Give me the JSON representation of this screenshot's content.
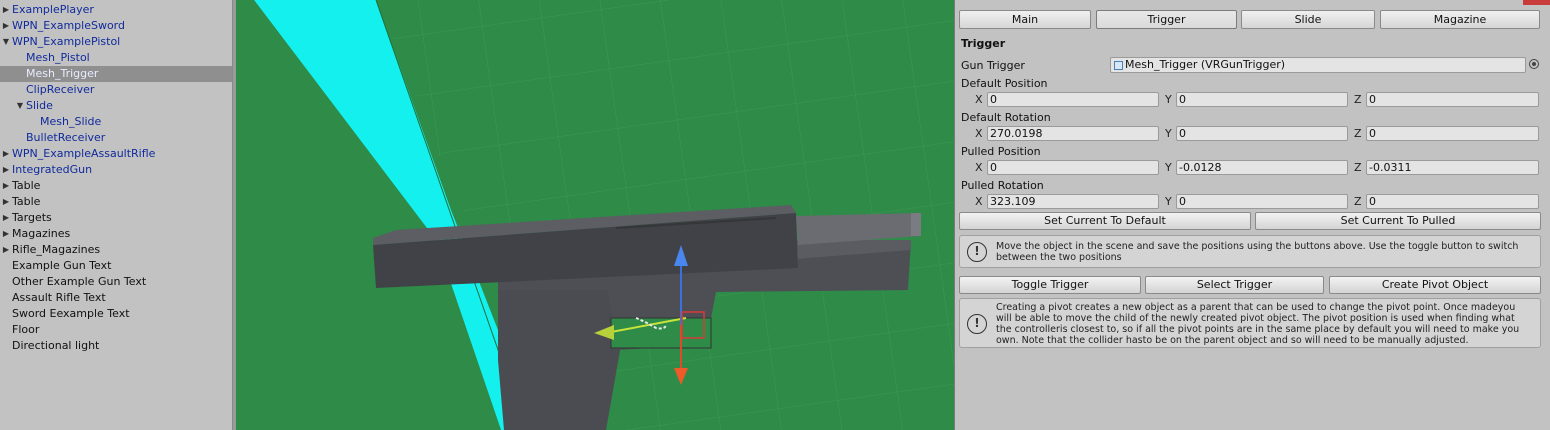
{
  "hierarchy": {
    "items": [
      {
        "label": "ExamplePlayer",
        "arrow": "▶",
        "color": "blue"
      },
      {
        "label": "WPN_ExampleSword",
        "arrow": "▶",
        "color": "blue"
      },
      {
        "label": "WPN_ExamplePistol",
        "arrow": "▼",
        "color": "blue"
      },
      {
        "label": "Mesh_Pistol",
        "arrow": "",
        "color": "blue"
      },
      {
        "label": "Mesh_Trigger",
        "arrow": "",
        "color": "blue",
        "selected": true
      },
      {
        "label": "ClipReceiver",
        "arrow": "",
        "color": "blue"
      },
      {
        "label": "Slide",
        "arrow": "▼",
        "color": "blue"
      },
      {
        "label": "Mesh_Slide",
        "arrow": "",
        "color": "blue"
      },
      {
        "label": "BulletReceiver",
        "arrow": "",
        "color": "blue"
      },
      {
        "label": "WPN_ExampleAssaultRifle",
        "arrow": "▶",
        "color": "blue"
      },
      {
        "label": "IntegratedGun",
        "arrow": "▶",
        "color": "blue"
      },
      {
        "label": "Table",
        "arrow": "▶",
        "color": "black"
      },
      {
        "label": "Table",
        "arrow": "▶",
        "color": "black"
      },
      {
        "label": "Targets",
        "arrow": "▶",
        "color": "black"
      },
      {
        "label": "Magazines",
        "arrow": "▶",
        "color": "black"
      },
      {
        "label": "Rifle_Magazines",
        "arrow": "▶",
        "color": "black"
      },
      {
        "label": "Example Gun Text",
        "arrow": "",
        "color": "black"
      },
      {
        "label": "Other Example Gun Text",
        "arrow": "",
        "color": "black"
      },
      {
        "label": "Assault Rifle Text",
        "arrow": "",
        "color": "black"
      },
      {
        "label": "Sword Eexample Text",
        "arrow": "",
        "color": "black"
      },
      {
        "label": "Floor",
        "arrow": "",
        "color": "black"
      },
      {
        "label": "Directional light",
        "arrow": "",
        "color": "black"
      }
    ]
  },
  "inspector": {
    "tabs": [
      "Main",
      "Trigger",
      "Slide",
      "Magazine"
    ],
    "active_tab": "Trigger",
    "section_title": "Trigger",
    "gun_trigger_label": "Gun Trigger",
    "gun_trigger_value": "Mesh_Trigger (VRGunTrigger)",
    "vectors": [
      {
        "label": "Default Position",
        "x": "0",
        "y": "0",
        "z": "0"
      },
      {
        "label": "Default Rotation",
        "x": "270.0198",
        "y": "0",
        "z": "0"
      },
      {
        "label": "Pulled Position",
        "x": "0",
        "y": "-0.0128",
        "z": "-0.0311"
      },
      {
        "label": "Pulled Rotation",
        "x": "323.109",
        "y": "0",
        "z": "0"
      }
    ],
    "axis_labels": {
      "x": "X",
      "y": "Y",
      "z": "Z"
    },
    "set_default_button": "Set Current To Default",
    "set_pulled_button": "Set Current To Pulled",
    "help1": "Move the object in the scene and save the positions using the buttons above. Use the toggle button to switch between the two positions",
    "toggle_button": "Toggle Trigger",
    "select_button": "Select Trigger",
    "pivot_button": "Create Pivot Object",
    "help2": "Creating a pivot creates a new object as a parent that can be used to change the pivot point. Once madeyou will be able to move the child of the newly created pivot object. The pivot position is used when finding what the controlleris closest to, so if all the pivot points are in the same place by default you will need to make you own. Note that the collider hasto be on the parent object and so will need to be manually adjusted.",
    "help_icon": "!"
  },
  "colors": {
    "scene_green": "#2e8b48",
    "cyan_wall": "#13f0ee",
    "gun_dark": "#46484e",
    "selected_row": "#8f8f8f"
  },
  "icons": [
    "expand-arrow-icon",
    "collapse-arrow-icon",
    "object-picker-icon",
    "info-icon",
    "script-icon"
  ]
}
